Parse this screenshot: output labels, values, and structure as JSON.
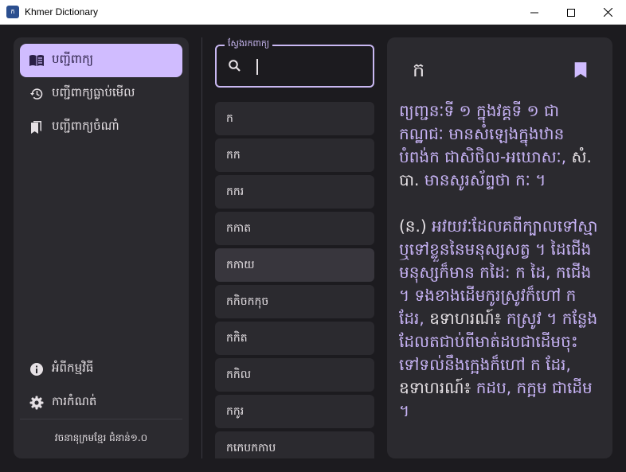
{
  "window": {
    "title": "Khmer Dictionary",
    "icon": "dictionary-app-icon"
  },
  "sidebar": {
    "items": [
      {
        "label": "បញ្ជីពាក្យ",
        "icon": "book-open-icon",
        "active": true
      },
      {
        "label": "បញ្ជីពាក្យធ្លាប់មើល",
        "icon": "history-icon",
        "active": false
      },
      {
        "label": "បញ្ជីពាក្យចំណាំ",
        "icon": "bookmarks-icon",
        "active": false
      }
    ],
    "bottom_items": [
      {
        "label": "អំពីកម្មវិធី",
        "icon": "info-icon"
      },
      {
        "label": "ការកំណត់",
        "icon": "gear-icon"
      }
    ],
    "version": "វចនានុក្រមខ្មែរ ជំនាន់១.០"
  },
  "search": {
    "label": "ស្វែងរកពាក្យ",
    "value": "",
    "icon": "search-icon"
  },
  "word_list": [
    "ក",
    "កក",
    "កករ",
    "កកាត",
    "កកាយ",
    "កកិចកកុច",
    "កកិត",
    "កកិល",
    "កកូរ",
    "កកេបកកាប"
  ],
  "hovered_word_index": 4,
  "detail": {
    "word": "ក",
    "bookmark_icon": "bookmark-icon",
    "paragraphs": [
      [
        {
          "text": "ព្យញ្ជនៈទី ១ ក្នុងវគ្គទី ១ ជា កណ្ឋជៈ មានសំឡេងក្នុងឋាន បំពង់ក ជាសិថិល-អឃោសៈ, ",
          "color": "accent"
        },
        {
          "text": "សំ. បា. ",
          "color": "white"
        },
        {
          "text": "មានសូរស័ព្ទថា កៈ ។",
          "color": "accent"
        }
      ],
      [
        {
          "text": "(ន.) ",
          "color": "white"
        },
        {
          "text": "អវយវៈដែលគពីក្បាលទៅស្មា ឬទៅខ្លួននៃមនុស្សសត្វ ។ ដៃជើងមនុស្សក៏មាន កដៃ: ក ដៃ, កជើង ។ ទងខាងដើមកូរស្រូវក៏ហៅ ក ដែរ, ",
          "color": "accent"
        },
        {
          "text": "ឧទាហរណ៍៖ ",
          "color": "white"
        },
        {
          "text": "កស្រូវ ។ កន្លែងដែលតជាប់ពីមាត់ដបជាដើមចុះទៅទល់នឹងក្អេងក៏ហៅ ក ដែរ, ",
          "color": "accent"
        },
        {
          "text": "ឧទាហរណ៍៖ ",
          "color": "white"
        },
        {
          "text": "កដប, កក្អម ជាដើម ។",
          "color": "accent"
        }
      ]
    ]
  },
  "colors": {
    "background": "#1c1b1f",
    "surface": "#2b2a2f",
    "accent": "#d0bcff",
    "definition_text": "#c7b3f5",
    "text": "#e6e1e5"
  }
}
